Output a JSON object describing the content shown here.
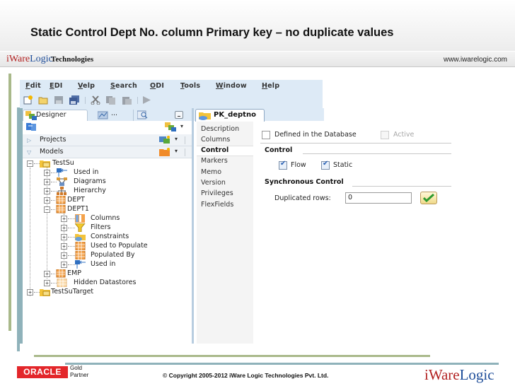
{
  "slide": {
    "title": "Static Control Dept No. column Primary key – no duplicate values",
    "brand_logo_part1": "iWare",
    "brand_logo_part2": "Logic",
    "brand_tech": "Technologies",
    "url": "www.iwarelogic.com"
  },
  "app": {
    "menu": [
      {
        "label": "File",
        "mnemonic": "F"
      },
      {
        "label": "Edit",
        "mnemonic": "E"
      },
      {
        "label": "View",
        "mnemonic": "V"
      },
      {
        "label": "Search",
        "mnemonic": "S"
      },
      {
        "label": "ODI",
        "mnemonic": "O"
      },
      {
        "label": "Tools",
        "mnemonic": "T"
      },
      {
        "label": "Window",
        "mnemonic": "W"
      },
      {
        "label": "Help",
        "mnemonic": "H"
      }
    ],
    "toolbar_icons": [
      "new-icon",
      "open-folder-icon",
      "save-icon",
      "save-all-icon",
      "cut-icon",
      "copy-icon",
      "paste-icon",
      "run-icon"
    ],
    "left_panel": {
      "tabs": [
        {
          "label": "Designer",
          "icon": "designer-icon"
        },
        {
          "label": "...",
          "icon": "operator-icon"
        },
        {
          "label": "",
          "icon": "search-icon"
        }
      ],
      "accordions": [
        {
          "label": "Projects",
          "state": "collapsed"
        },
        {
          "label": "Models",
          "state": "expanded"
        }
      ],
      "tree": [
        {
          "label": "TestSu",
          "level": 0,
          "expander": "-",
          "icon": "model-folder-icon"
        },
        {
          "label": "Used in",
          "level": 1,
          "expander": "+",
          "icon": "used-in-icon"
        },
        {
          "label": "Diagrams",
          "level": 1,
          "expander": "+",
          "icon": "diagrams-icon"
        },
        {
          "label": "Hierarchy",
          "level": 1,
          "expander": "+",
          "icon": "hierarchy-icon"
        },
        {
          "label": "DEPT",
          "level": 1,
          "expander": "+",
          "icon": "datastore-icon"
        },
        {
          "label": "DEPT1",
          "level": 1,
          "expander": "-",
          "icon": "datastore-icon"
        },
        {
          "label": "Columns",
          "level": 2,
          "expander": "+",
          "icon": "columns-icon"
        },
        {
          "label": "Filters",
          "level": 2,
          "expander": "+",
          "icon": "filter-icon"
        },
        {
          "label": "Constraints",
          "level": 2,
          "expander": "+",
          "icon": "constraints-icon"
        },
        {
          "label": "Used to Populate",
          "level": 2,
          "expander": "+",
          "icon": "table-icon"
        },
        {
          "label": "Populated By",
          "level": 2,
          "expander": "+",
          "icon": "table-icon"
        },
        {
          "label": "Used in",
          "level": 2,
          "expander": "+",
          "icon": "used-in-icon"
        },
        {
          "label": "EMP",
          "level": 1,
          "expander": "+",
          "icon": "datastore-icon"
        },
        {
          "label": "Hidden Datastores",
          "level": 1,
          "expander": "+",
          "icon": "hidden-datastore-icon"
        },
        {
          "label": "TestSuTarget",
          "level": 0,
          "expander": "+",
          "icon": "model-folder-icon"
        }
      ]
    },
    "editor": {
      "tab_label": "PK_deptno",
      "side_nav": [
        "Description",
        "Columns",
        "Control",
        "Markers",
        "Memo",
        "Version",
        "Privileges",
        "FlexFields"
      ],
      "active_nav": "Control",
      "defined_in_db": {
        "label": "Defined in the Database",
        "checked": false
      },
      "active": {
        "label": "Active",
        "checked": false,
        "disabled": true
      },
      "control_heading": "Control",
      "flow": {
        "label": "Flow",
        "checked": true
      },
      "static": {
        "label": "Static",
        "checked": true
      },
      "sync_heading": "Synchronous Control",
      "duplicated_rows_label": "Duplicated rows:",
      "duplicated_rows_value": "0"
    }
  },
  "footer": {
    "oracle": "ORACLE",
    "gold": "Gold",
    "partner": "Partner",
    "copyright": "© Copyright 2005-2012 iWare Logic Technologies Pvt. Ltd.",
    "logo_part1": "iWare",
    "logo_part2": "Logic"
  }
}
